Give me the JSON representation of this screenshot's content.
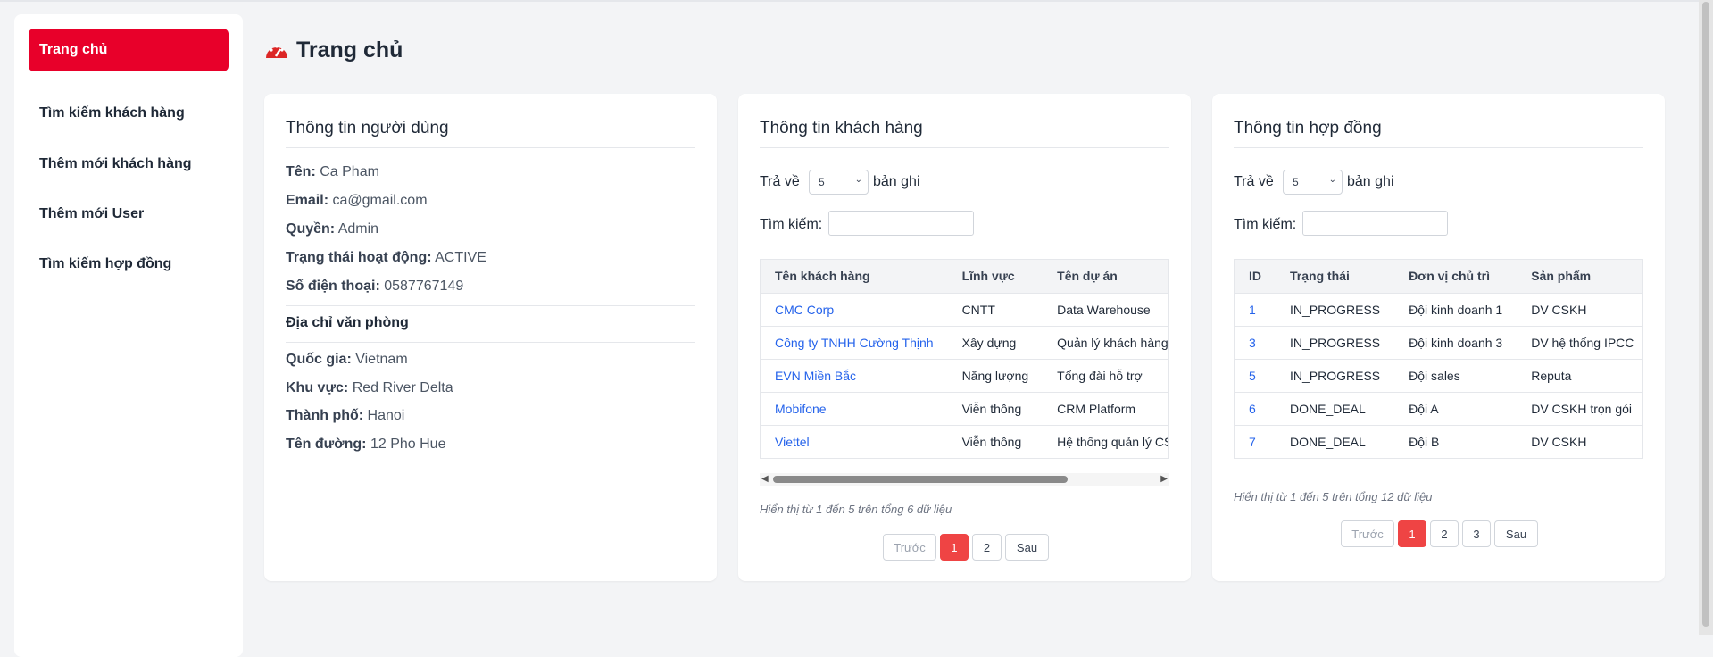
{
  "sidebar": {
    "items": [
      {
        "label": "Trang chủ",
        "active": true
      },
      {
        "label": "Tìm kiếm khách hàng"
      },
      {
        "label": "Thêm mới khách hàng"
      },
      {
        "label": "Thêm mới User"
      },
      {
        "label": "Tìm kiếm hợp đồng"
      }
    ]
  },
  "header": {
    "title": "Trang chủ",
    "icon": "gauge-icon"
  },
  "user_card": {
    "title": "Thông tin người dùng",
    "fields": [
      {
        "label": "Tên:",
        "value": "Ca Pham"
      },
      {
        "label": "Email:",
        "value": "ca@gmail.com"
      },
      {
        "label": "Quyền:",
        "value": "Admin"
      },
      {
        "label": "Trạng thái hoạt động:",
        "value": "ACTIVE"
      },
      {
        "label": "Số điện thoại:",
        "value": "0587767149"
      }
    ],
    "address_title": "Địa chỉ văn phòng",
    "address": [
      {
        "label": "Quốc gia:",
        "value": "Vietnam"
      },
      {
        "label": "Khu vực:",
        "value": "Red River Delta"
      },
      {
        "label": "Thành phố:",
        "value": "Hanoi"
      },
      {
        "label": "Tên đường:",
        "value": "12 Pho Hue"
      }
    ]
  },
  "customer_card": {
    "title": "Thông tin khách hàng",
    "show_label": "Trả về",
    "page_size": "5",
    "records_label": "bản ghi",
    "search_label": "Tìm kiếm:",
    "search_value": "",
    "columns": [
      "Tên khách hàng",
      "Lĩnh vực",
      "Tên dự án"
    ],
    "rows": [
      [
        "CMC Corp",
        "CNTT",
        "Data Warehouse"
      ],
      [
        "Công ty TNHH Cường Thịnh",
        "Xây dựng",
        "Quản lý khách hàng"
      ],
      [
        "EVN Miền Bắc",
        "Năng lượng",
        "Tổng đài hỗ trợ"
      ],
      [
        "Mobifone",
        "Viễn thông",
        "CRM Platform"
      ],
      [
        "Viettel",
        "Viễn thông",
        "Hệ thống quản lý CSKH"
      ]
    ],
    "info": "Hiển thị từ 1 đến 5 trên tổng 6 dữ liệu",
    "prev": "Trước",
    "next": "Sau",
    "pages": [
      "1",
      "2"
    ]
  },
  "contract_card": {
    "title": "Thông tin hợp đồng",
    "show_label": "Trả về",
    "page_size": "5",
    "records_label": "bản ghi",
    "search_label": "Tìm kiếm:",
    "search_value": "",
    "columns": [
      "ID",
      "Trạng thái",
      "Đơn vị chủ trì",
      "Sản phẩm"
    ],
    "rows": [
      [
        "1",
        "IN_PROGRESS",
        "Đội kinh doanh 1",
        "DV CSKH"
      ],
      [
        "3",
        "IN_PROGRESS",
        "Đội kinh doanh 3",
        "DV hệ thống IPCC"
      ],
      [
        "5",
        "IN_PROGRESS",
        "Đội sales",
        "Reputa"
      ],
      [
        "6",
        "DONE_DEAL",
        "Đội A",
        "DV CSKH trọn gói"
      ],
      [
        "7",
        "DONE_DEAL",
        "Đội B",
        "DV CSKH"
      ]
    ],
    "info": "Hiển thị từ 1 đến 5 trên tổng 12 dữ liệu",
    "prev": "Trước",
    "next": "Sau",
    "pages": [
      "1",
      "2",
      "3"
    ]
  },
  "colors": {
    "accent": "#e8002a",
    "page_active": "#ef4444",
    "link": "#2563eb"
  }
}
